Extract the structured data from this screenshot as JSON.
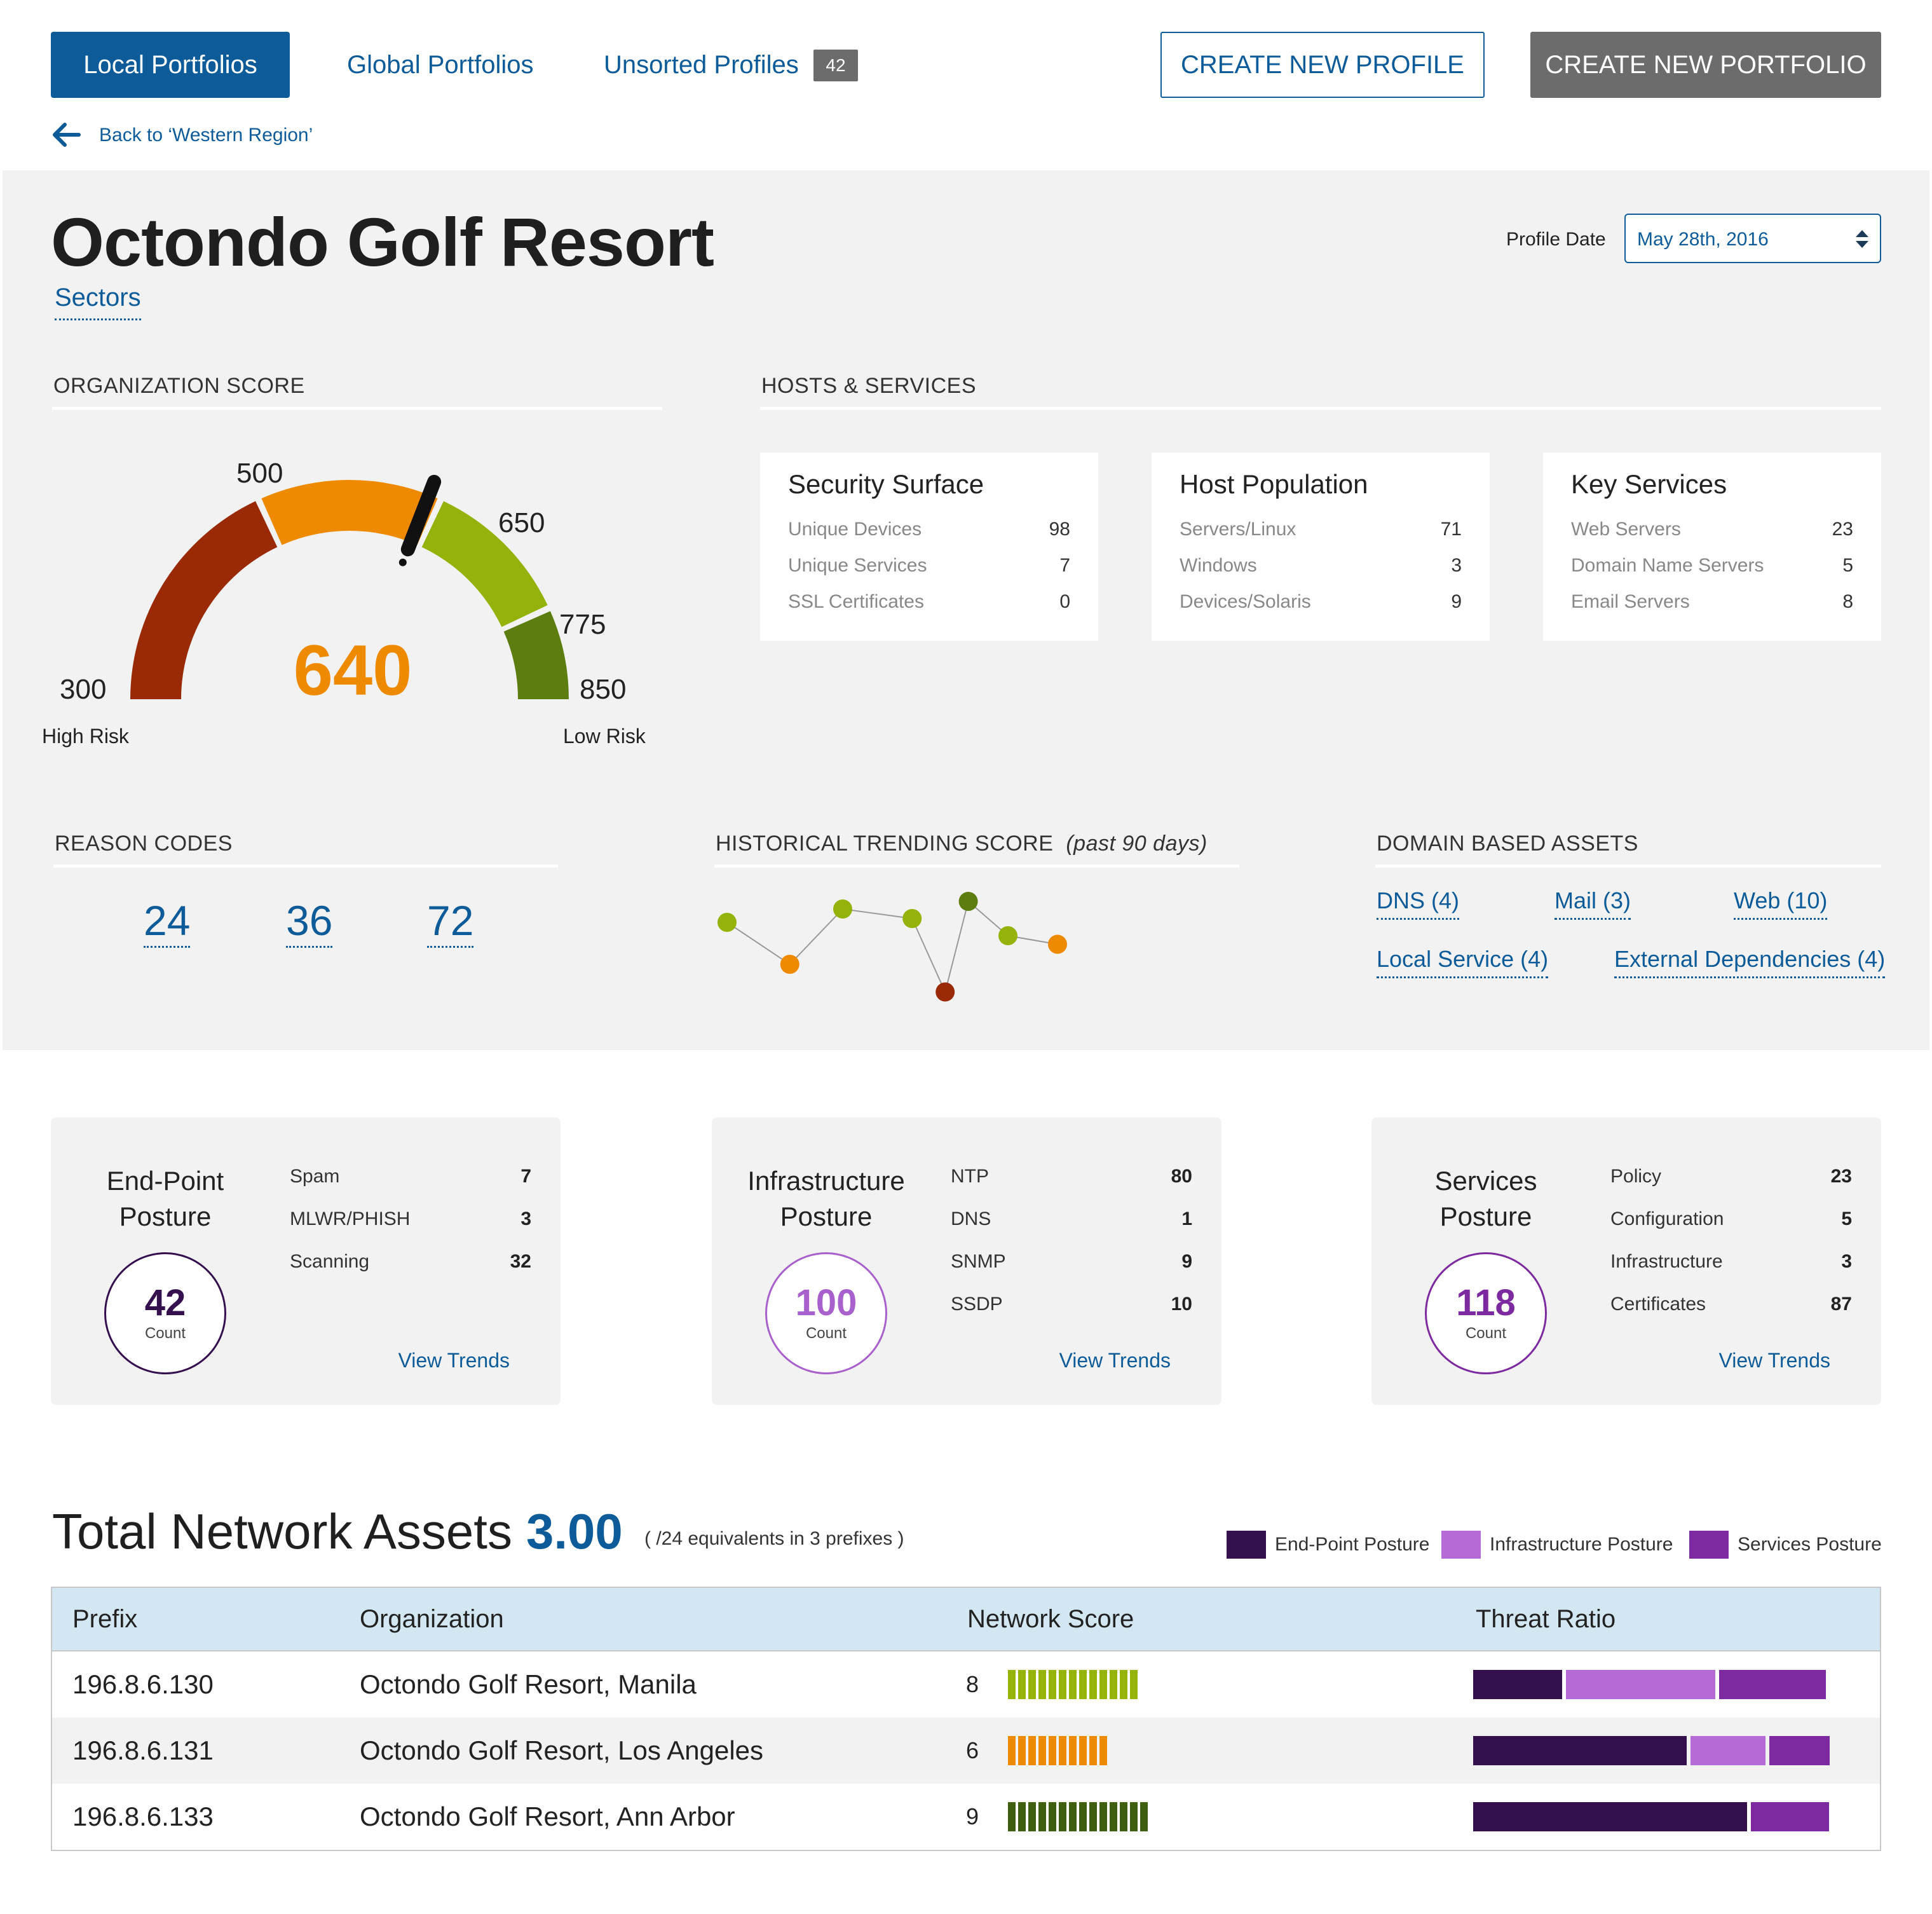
{
  "header": {
    "tabs": [
      {
        "label": "Local Portfolios",
        "active": true
      },
      {
        "label": "Global Portfolios"
      },
      {
        "label": "Unsorted Profiles",
        "badge": "42"
      }
    ],
    "create_profile": "CREATE NEW PROFILE",
    "create_portfolio": "CREATE NEW PORTFOLIO",
    "back_link": "Back to ‘Western Region’"
  },
  "profile": {
    "title": "Octondo Golf Resort",
    "sectors_link": "Sectors",
    "date_label": "Profile Date",
    "date_value": "May 28th, 2016"
  },
  "org_score": {
    "heading": "ORGANIZATION SCORE",
    "score": 640,
    "score_text": "640",
    "ticks": [
      "300",
      "500",
      "650",
      "775",
      "850"
    ],
    "high_label": "High Risk",
    "low_label": "Low Risk",
    "bands": [
      {
        "from": 300,
        "to": 500,
        "color": "#9a2a06"
      },
      {
        "from": 500,
        "to": 650,
        "color": "#ee8a00"
      },
      {
        "from": 650,
        "to": 775,
        "color": "#93b30a"
      },
      {
        "from": 775,
        "to": 850,
        "color": "#5d7d10"
      }
    ]
  },
  "hosts": {
    "heading": "HOSTS & SERVICES",
    "cards": [
      {
        "title": "Security Surface",
        "rows": [
          [
            "Unique Devices",
            "98"
          ],
          [
            "Unique Services",
            "7"
          ],
          [
            "SSL Certificates",
            "0"
          ]
        ]
      },
      {
        "title": "Host Population",
        "rows": [
          [
            "Servers/Linux",
            "71"
          ],
          [
            "Windows",
            "3"
          ],
          [
            "Devices/Solaris",
            "9"
          ]
        ]
      },
      {
        "title": "Key Services",
        "rows": [
          [
            "Web Servers",
            "23"
          ],
          [
            "Domain Name Servers",
            "5"
          ],
          [
            "Email Servers",
            "8"
          ]
        ]
      }
    ]
  },
  "reason_codes": {
    "heading": "REASON CODES",
    "codes": [
      "24",
      "36",
      "72"
    ]
  },
  "trending": {
    "heading": "HISTORICAL TRENDING SCORE",
    "subheading": "(past 90 days)",
    "colors": [
      "#93b30a",
      "#ee8a00",
      "#93b30a",
      "#93b30a",
      "#9a2a06",
      "#5d7d10",
      "#93b30a",
      "#ee8a00"
    ]
  },
  "domain_assets": {
    "heading": "DOMAIN BASED ASSETS",
    "links": [
      "DNS (4)",
      "Mail (3)",
      "Web (10)",
      "Local Service (4)",
      "External Dependencies (4)"
    ]
  },
  "postures": [
    {
      "title_line1": "End-Point",
      "title_line2": "Posture",
      "count": "42",
      "count_label": "Count",
      "color": "#35104e",
      "rows": [
        [
          "Spam",
          "7"
        ],
        [
          "MLWR/PHISH",
          "3"
        ],
        [
          "Scanning",
          "32"
        ]
      ],
      "link": "View Trends"
    },
    {
      "title_line1": "Infrastructure",
      "title_line2": "Posture",
      "count": "100",
      "count_label": "Count",
      "color": "#a860cc",
      "rows": [
        [
          "NTP",
          "80"
        ],
        [
          "DNS",
          "1"
        ],
        [
          "SNMP",
          "9"
        ],
        [
          "SSDP",
          "10"
        ]
      ],
      "link": "View Trends"
    },
    {
      "title_line1": "Services",
      "title_line2": "Posture",
      "count": "118",
      "count_label": "Count",
      "color": "#7d2aa0",
      "rows": [
        [
          "Policy",
          "23"
        ],
        [
          "Configuration",
          "5"
        ],
        [
          "Infrastructure",
          "3"
        ],
        [
          "Certificates",
          "87"
        ]
      ],
      "link": "View Trends"
    }
  ],
  "network_assets": {
    "title": "Total Network Assets",
    "value": "3.00",
    "subtitle": "( /24 equivalents in 3 prefixes )",
    "legend": [
      {
        "label": "End-Point Posture",
        "color": "#35104e"
      },
      {
        "label": "Infrastructure Posture",
        "color": "#b56ad6"
      },
      {
        "label": "Services Posture",
        "color": "#7d2aa0"
      }
    ],
    "columns": [
      "Prefix",
      "Organization",
      "Network Score",
      "Threat Ratio"
    ],
    "rows": [
      {
        "prefix": "196.8.6.130",
        "org": "Octondo Golf Resort, Manila",
        "score": "8",
        "score_color": "#93b30a",
        "threat": [
          0.25,
          0.42,
          0.3
        ]
      },
      {
        "prefix": "196.8.6.131",
        "org": "Octondo Golf Resort, Los Angeles",
        "score": "6",
        "score_color": "#ee8a00",
        "threat": [
          0.6,
          0.21,
          0.17
        ]
      },
      {
        "prefix": "196.8.6.133",
        "org": "Octondo Golf Resort, Ann Arbor",
        "score": "9",
        "score_color": "#3f5e10",
        "threat": [
          0.77,
          0.22
        ]
      }
    ]
  }
}
